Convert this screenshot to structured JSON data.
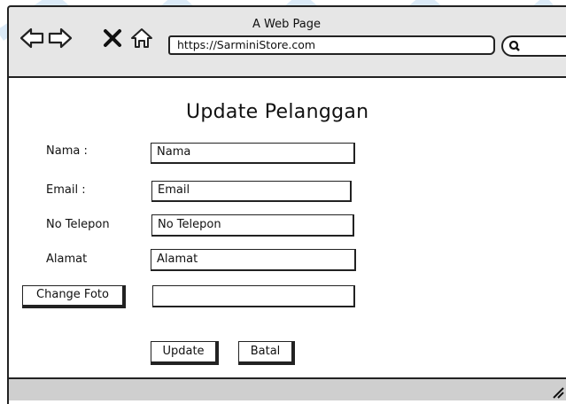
{
  "window": {
    "title": "A Web Page",
    "url": "https://SarminiStore.com"
  },
  "icons": {
    "back": "back-arrow-icon",
    "forward": "forward-arrow-icon",
    "close": "close-x-icon",
    "home": "home-icon",
    "search": "search-icon",
    "grip": "resize-grip-icon"
  },
  "form": {
    "heading": "Update Pelanggan",
    "nama_label": "Nama :",
    "nama_value": "Nama",
    "email_label": "Email :",
    "email_value": "Email",
    "telepon_label": "No Telepon",
    "telepon_value": "No Telepon",
    "alamat_label": "Alamat",
    "alamat_value": "Alamat",
    "change_foto_label": "Change Foto",
    "foto_value": "",
    "update_label": "Update",
    "batal_label": "Batal"
  },
  "colors": {
    "titlebar": "#e6e6e6",
    "statusbar": "#cfcfcf",
    "decoration": "#dbeaf7"
  }
}
